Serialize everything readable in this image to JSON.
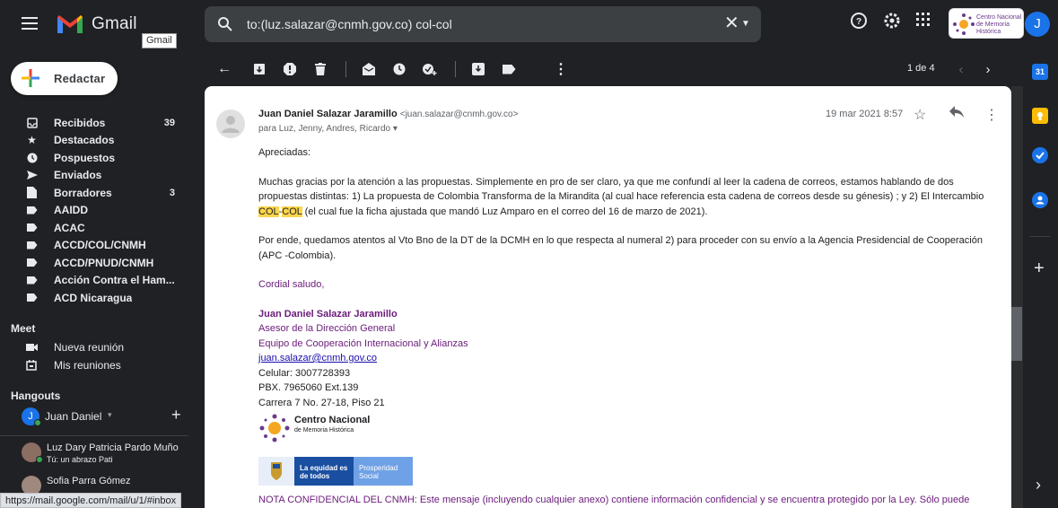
{
  "app": {
    "name": "Gmail",
    "tooltip": "Gmail"
  },
  "search": {
    "query": "to:(luz.salazar@cnmh.gov.co) col-col"
  },
  "brand": {
    "line1": "Centro Nacional",
    "line2": "de Memoria Histórica"
  },
  "account": {
    "initial": "J"
  },
  "compose": {
    "label": "Redactar"
  },
  "nav": [
    {
      "label": "Recibidos",
      "count": "39",
      "icon": "inbox-icon"
    },
    {
      "label": "Destacados",
      "count": "",
      "icon": "star-icon"
    },
    {
      "label": "Pospuestos",
      "count": "",
      "icon": "clock-icon"
    },
    {
      "label": "Enviados",
      "count": "",
      "icon": "send-icon"
    },
    {
      "label": "Borradores",
      "count": "3",
      "icon": "draft-icon"
    },
    {
      "label": "AAIDD",
      "count": "",
      "icon": "label-icon"
    },
    {
      "label": "ACAC",
      "count": "",
      "icon": "label-icon"
    },
    {
      "label": "ACCD/COL/CNMH",
      "count": "",
      "icon": "label-icon"
    },
    {
      "label": "ACCD/PNUD/CNMH",
      "count": "",
      "icon": "label-icon"
    },
    {
      "label": "Acción Contra el Ham...",
      "count": "",
      "icon": "label-icon"
    },
    {
      "label": "ACD Nicaragua",
      "count": "",
      "icon": "label-icon"
    }
  ],
  "meet": {
    "title": "Meet",
    "new_meeting": "Nueva reunión",
    "my_meetings": "Mis reuniones"
  },
  "hangouts": {
    "title": "Hangouts",
    "user": "Juan Daniel",
    "user_initial": "J"
  },
  "contacts": [
    {
      "name": "Luz Dary Patricia Pardo Muño",
      "sub": "Tú: un abrazo Pati"
    },
    {
      "name": "Sofia Parra Gómez",
      "sub": ""
    }
  ],
  "status_url": "https://mail.google.com/mail/u/1/#inbox",
  "pager": {
    "text": "1 de 4"
  },
  "email": {
    "sender_name": "Juan Daniel Salazar Jaramillo",
    "sender_email": "<juan.salazar@cnmh.gov.co>",
    "to": "para Luz, Jenny, Andres, Ricardo",
    "date": "19 mar 2021 8:57",
    "greeting": "Apreciadas:",
    "p1_a": "Muchas gracias por la atención a las propuestas. Simplemente en pro de ser claro, ya que me confundí al leer la cadena de correos, estamos hablando de dos propuestas distintas: 1) La propuesta de Colombia Transforma de la Mirandita (al cual hace referencia esta cadena de correos desde su génesis) ; y 2) El Intercambio ",
    "p1_hl1": "COL",
    "p1_dash": "-",
    "p1_hl2": "COL",
    "p1_b": " (el cual fue la ficha ajustada que mandó Luz Amparo en el correo del 16 de marzo de 2021).",
    "p2": "Por ende, quedamos atentos al Vto Bno de la DT de la DCMH en lo que respecta al numeral 2) para proceder con su envío a la Agencia Presidencial de Cooperación (APC -Colombia).",
    "closing": "Cordial saludo,",
    "sig_name": "Juan Daniel Salazar Jaramillo",
    "sig_title": "Asesor de la Dirección General",
    "sig_team": "Equipo de Cooperación Internacional y Alianzas",
    "sig_email": "juan.salazar@cnmh.gov.co",
    "sig_phone": "Celular: 3007728393",
    "sig_pbx": "PBX. 7965060 Ext.139",
    "sig_address": "Carrera 7 No. 27-18, Piso 21",
    "logo_line1": "Centro Nacional",
    "logo_line2": "de Memoria Histórica",
    "banner1": "La equidad es de todos",
    "banner2": "Prosperidad Social",
    "notice": "NOTA CONFIDENCIAL DEL CNMH: Este mensaje (incluyendo cualquier anexo) contiene información confidencial y se encuentra protegido por la Ley. Sólo puede"
  }
}
